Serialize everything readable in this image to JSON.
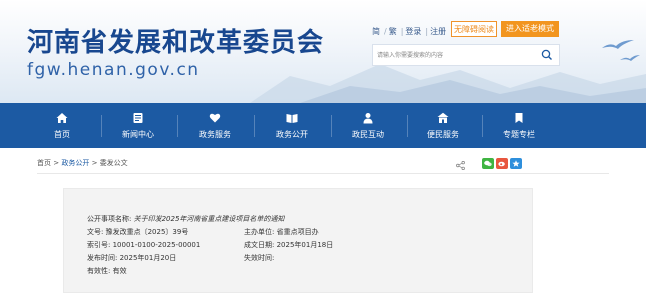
{
  "header": {
    "site_title": "河南省发展和改革委员会",
    "site_domain": "fgw.henan.gov.cn",
    "links": [
      "简",
      "繁",
      "登录",
      "注册"
    ],
    "accessibility_label": "无障碍阅读",
    "elder_mode_label": "进入适老模式",
    "search": {
      "placeholder": "请输入你需要搜索的内容"
    }
  },
  "nav": {
    "items": [
      {
        "label": "首页",
        "icon": "home-icon"
      },
      {
        "label": "新闻中心",
        "icon": "news-icon"
      },
      {
        "label": "政务服务",
        "icon": "heart-service-icon"
      },
      {
        "label": "政务公开",
        "icon": "open-book-icon"
      },
      {
        "label": "政民互动",
        "icon": "people-icon"
      },
      {
        "label": "便民服务",
        "icon": "house-service-icon"
      },
      {
        "label": "专题专栏",
        "icon": "bookmark-icon"
      }
    ]
  },
  "breadcrumb": {
    "home": "首页",
    "sep": ">",
    "level1": "政务公开",
    "current": "委发公文"
  },
  "share": {
    "icons": [
      "share-icon",
      "wechat-icon",
      "weibo-icon",
      "qzone-icon"
    ]
  },
  "info": {
    "title_label": "公开事项名称:",
    "title_value": "关于印发2025年河南省重点建设项目名单的通知",
    "doc_no_label": "文号:",
    "doc_no_value": "豫发改重点〔2025〕39号",
    "org_label": "主办单位:",
    "org_value": "省重点项目办",
    "index_label": "索引号:",
    "index_value": "10001-0100-2025-00001",
    "date_label": "成文日期:",
    "date_value": "2025年01月18日",
    "publish_label": "发布时间:",
    "publish_value": "2025年01月20日",
    "expire_label": "失效时间:",
    "expire_value": "",
    "valid_label": "有效性:",
    "valid_value": "有效"
  },
  "colors": {
    "brand_blue": "#1c5aa3",
    "title_blue": "#18478f",
    "accent_orange": "#f2951f"
  }
}
